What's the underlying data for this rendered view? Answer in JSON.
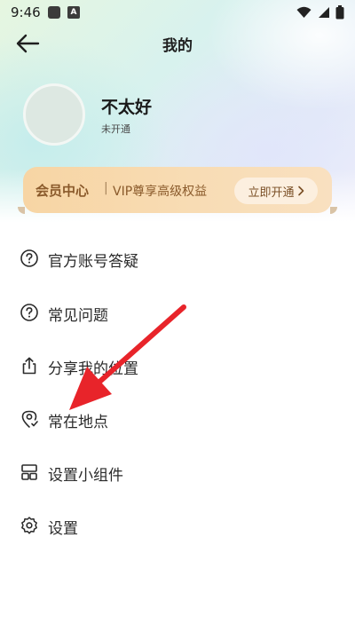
{
  "status_bar": {
    "time": "9:46",
    "app_icon_letter": "A"
  },
  "header": {
    "title": "我的"
  },
  "profile": {
    "name": "不太好",
    "status": "未开通"
  },
  "vip": {
    "title": "会员中心",
    "separator": "|",
    "subtitle": "VIP尊享高级权益",
    "button_label": "立即开通"
  },
  "menu": {
    "items": [
      {
        "label": "官方账号答疑",
        "icon": "question-circle-icon"
      },
      {
        "label": "常见问题",
        "icon": "question-circle-icon"
      },
      {
        "label": "分享我的位置",
        "icon": "share-icon"
      },
      {
        "label": "常在地点",
        "icon": "location-pin-icon"
      },
      {
        "label": "设置小组件",
        "icon": "widget-grid-icon"
      },
      {
        "label": "设置",
        "icon": "gear-icon"
      }
    ]
  },
  "colors": {
    "vip_text": "#8a5a2b",
    "vip_bg": "#f7d5a4",
    "annotation_arrow": "#e8242a"
  }
}
